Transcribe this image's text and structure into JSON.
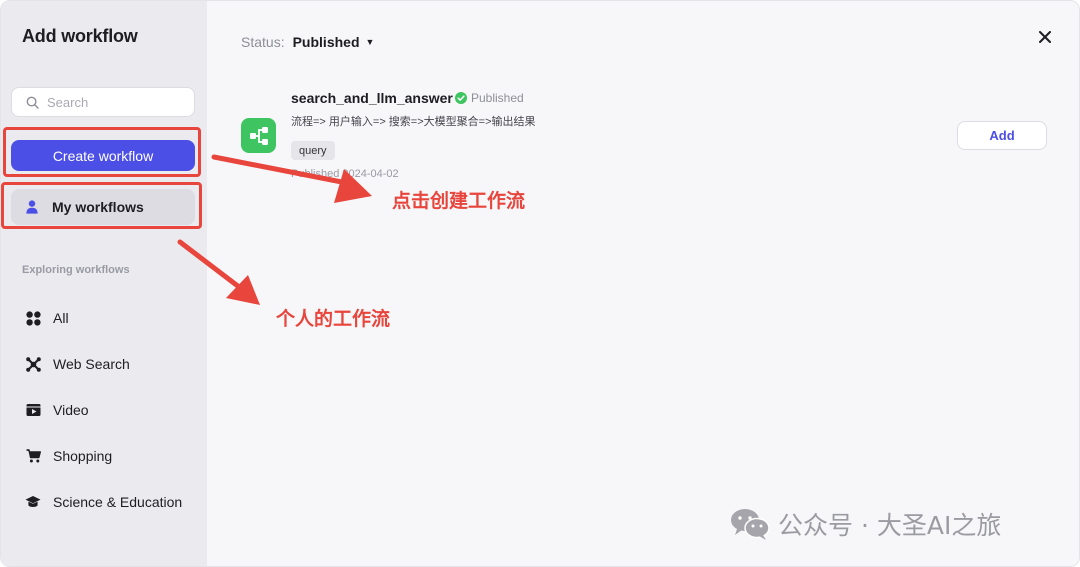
{
  "dialog": {
    "title": "Add workflow",
    "close_label": "×"
  },
  "sidebar": {
    "search_placeholder": "Search",
    "create_button_label": "Create workflow",
    "my_workflows_label": "My workflows",
    "section_label": "Exploring workflows",
    "categories": [
      {
        "label": "All",
        "icon": "grid-icon"
      },
      {
        "label": "Web Search",
        "icon": "web-search-icon"
      },
      {
        "label": "Video",
        "icon": "video-icon"
      },
      {
        "label": "Shopping",
        "icon": "cart-icon"
      },
      {
        "label": "Science & Education",
        "icon": "graduation-cap-icon"
      }
    ]
  },
  "main": {
    "status_label": "Status:",
    "status_value": "Published",
    "workflow": {
      "name": "search_and_llm_answer",
      "badge": "Published",
      "description": "流程=> 用户输入=> 搜索=>大模型聚合=>输出结果",
      "tag": "query",
      "published_date": "Published 2024-04-02",
      "add_label": "Add"
    }
  },
  "annotations": {
    "create_hint": "点击创建工作流",
    "my_hint": "个人的工作流",
    "color": "#e8453c"
  },
  "watermark": {
    "text": "公众号 · 大圣AI之旅"
  },
  "colors": {
    "accent": "#4c4fe6",
    "workflow_icon_bg": "#3ec460",
    "published_green": "#3ec460",
    "sidebar_bg": "#ebebef"
  }
}
